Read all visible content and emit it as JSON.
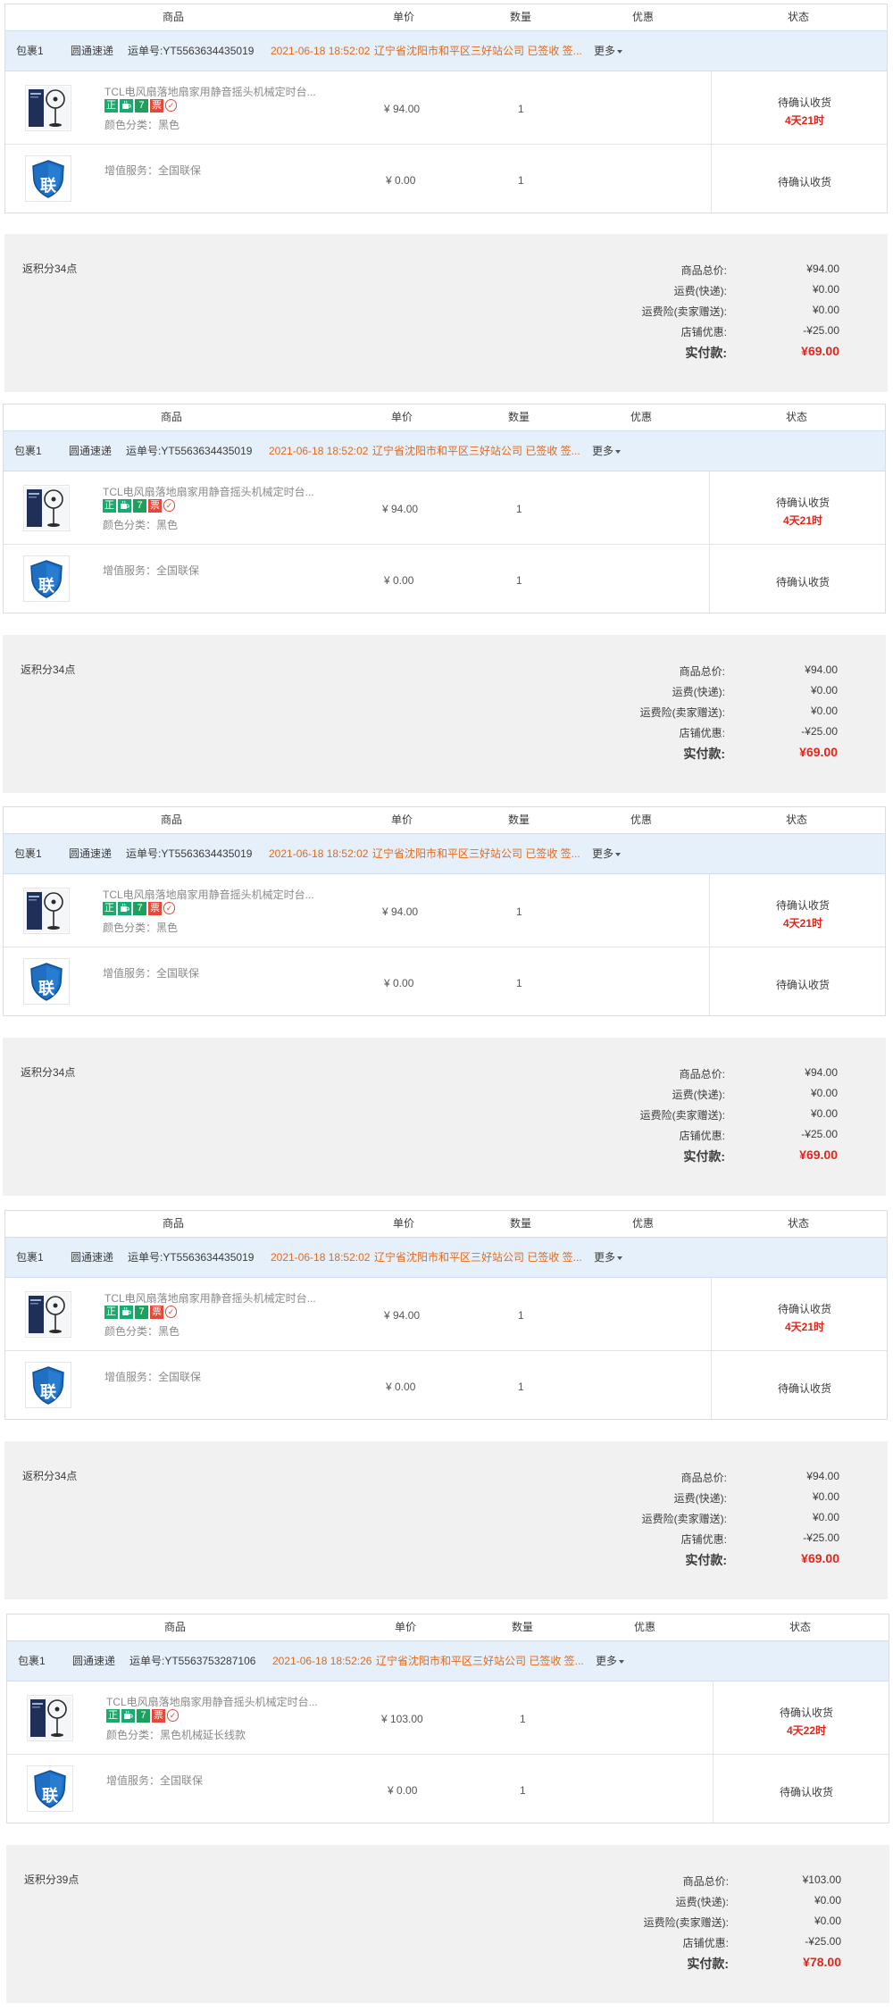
{
  "header": {
    "product": "商品",
    "unit_price": "单价",
    "quantity": "数量",
    "discount": "优惠",
    "status": "状态"
  },
  "icons": {
    "fan": "fan-product-icon",
    "service": "lian-warranty-shield-icon"
  },
  "colors": {
    "accent_orange": "#e06a1c",
    "price_red": "#e4251b",
    "package_bg": "#e6f0fb",
    "summary_bg": "#f1f1f1"
  },
  "orders": [
    {
      "package": {
        "label": "包裹1",
        "carrier": "圆通速递",
        "tracking": "运单号:YT5563634435019",
        "time": "2021-06-18 18:52:02",
        "location": "辽宁省沈阳市和平区三好站公司 已签收 签...",
        "more": "更多"
      },
      "item": {
        "title": "TCL电风扇落地扇家用静音摇头机械定时台...",
        "tags": [
          "正",
          "tea",
          "7",
          "票",
          "v"
        ],
        "sku": "颜色分类：黑色",
        "price": "¥ 94.00",
        "qty": "1",
        "status": "待确认收货",
        "countdown": "4天21时"
      },
      "service": {
        "icon_text": "联",
        "label": "增值服务：全国联保",
        "price": "¥ 0.00",
        "qty": "1",
        "status": "待确认收货"
      },
      "summary": {
        "points": "返积分34点",
        "rows": [
          {
            "label": "商品总价:",
            "value": "¥94.00"
          },
          {
            "label": "运费(快递):",
            "value": "¥0.00"
          },
          {
            "label": "运费险(卖家赠送):",
            "value": "¥0.00"
          },
          {
            "label": "店铺优惠:",
            "value": "-¥25.00"
          }
        ],
        "total_label": "实付款:",
        "total_value": "¥69.00"
      }
    },
    {
      "package": {
        "label": "包裹1",
        "carrier": "圆通速递",
        "tracking": "运单号:YT5563634435019",
        "time": "2021-06-18 18:52:02",
        "location": "辽宁省沈阳市和平区三好站公司 已签收 签...",
        "more": "更多"
      },
      "item": {
        "title": "TCL电风扇落地扇家用静音摇头机械定时台...",
        "tags": [
          "正",
          "tea",
          "7",
          "票",
          "v"
        ],
        "sku": "颜色分类：黑色",
        "price": "¥ 94.00",
        "qty": "1",
        "status": "待确认收货",
        "countdown": "4天21时"
      },
      "service": {
        "icon_text": "联",
        "label": "增值服务：全国联保",
        "price": "¥ 0.00",
        "qty": "1",
        "status": "待确认收货"
      },
      "summary": {
        "points": "返积分34点",
        "rows": [
          {
            "label": "商品总价:",
            "value": "¥94.00"
          },
          {
            "label": "运费(快递):",
            "value": "¥0.00"
          },
          {
            "label": "运费险(卖家赠送):",
            "value": "¥0.00"
          },
          {
            "label": "店铺优惠:",
            "value": "-¥25.00"
          }
        ],
        "total_label": "实付款:",
        "total_value": "¥69.00"
      }
    },
    {
      "package": {
        "label": "包裹1",
        "carrier": "圆通速递",
        "tracking": "运单号:YT5563634435019",
        "time": "2021-06-18 18:52:02",
        "location": "辽宁省沈阳市和平区三好站公司 已签收 签...",
        "more": "更多"
      },
      "item": {
        "title": "TCL电风扇落地扇家用静音摇头机械定时台...",
        "tags": [
          "正",
          "tea",
          "7",
          "票",
          "v"
        ],
        "sku": "颜色分类：黑色",
        "price": "¥ 94.00",
        "qty": "1",
        "status": "待确认收货",
        "countdown": "4天21时"
      },
      "service": {
        "icon_text": "联",
        "label": "增值服务：全国联保",
        "price": "¥ 0.00",
        "qty": "1",
        "status": "待确认收货"
      },
      "summary": {
        "points": "返积分34点",
        "rows": [
          {
            "label": "商品总价:",
            "value": "¥94.00"
          },
          {
            "label": "运费(快递):",
            "value": "¥0.00"
          },
          {
            "label": "运费险(卖家赠送):",
            "value": "¥0.00"
          },
          {
            "label": "店铺优惠:",
            "value": "-¥25.00"
          }
        ],
        "total_label": "实付款:",
        "total_value": "¥69.00"
      }
    },
    {
      "package": {
        "label": "包裹1",
        "carrier": "圆通速递",
        "tracking": "运单号:YT5563634435019",
        "time": "2021-06-18 18:52:02",
        "location": "辽宁省沈阳市和平区三好站公司 已签收 签...",
        "more": "更多"
      },
      "item": {
        "title": "TCL电风扇落地扇家用静音摇头机械定时台...",
        "tags": [
          "正",
          "tea",
          "7",
          "票",
          "v"
        ],
        "sku": "颜色分类：黑色",
        "price": "¥ 94.00",
        "qty": "1",
        "status": "待确认收货",
        "countdown": "4天21时"
      },
      "service": {
        "icon_text": "联",
        "label": "增值服务：全国联保",
        "price": "¥ 0.00",
        "qty": "1",
        "status": "待确认收货"
      },
      "summary": {
        "points": "返积分34点",
        "rows": [
          {
            "label": "商品总价:",
            "value": "¥94.00"
          },
          {
            "label": "运费(快递):",
            "value": "¥0.00"
          },
          {
            "label": "运费险(卖家赠送):",
            "value": "¥0.00"
          },
          {
            "label": "店铺优惠:",
            "value": "-¥25.00"
          }
        ],
        "total_label": "实付款:",
        "total_value": "¥69.00"
      }
    },
    {
      "package": {
        "label": "包裹1",
        "carrier": "圆通速递",
        "tracking": "运单号:YT5563753287106",
        "time": "2021-06-18 18:52:26",
        "location": "辽宁省沈阳市和平区三好站公司 已签收 签...",
        "more": "更多"
      },
      "item": {
        "title": "TCL电风扇落地扇家用静音摇头机械定时台...",
        "tags": [
          "正",
          "tea",
          "7",
          "票",
          "v"
        ],
        "sku": "颜色分类：黑色机械延长线款",
        "price": "¥ 103.00",
        "qty": "1",
        "status": "待确认收货",
        "countdown": "4天22时"
      },
      "service": {
        "icon_text": "联",
        "label": "增值服务：全国联保",
        "price": "¥ 0.00",
        "qty": "1",
        "status": "待确认收货"
      },
      "summary": {
        "points": "返积分39点",
        "rows": [
          {
            "label": "商品总价:",
            "value": "¥103.00"
          },
          {
            "label": "运费(快递):",
            "value": "¥0.00"
          },
          {
            "label": "运费险(卖家赠送):",
            "value": "¥0.00"
          },
          {
            "label": "店铺优惠:",
            "value": "-¥25.00"
          }
        ],
        "total_label": "实付款:",
        "total_value": "¥78.00"
      }
    }
  ]
}
